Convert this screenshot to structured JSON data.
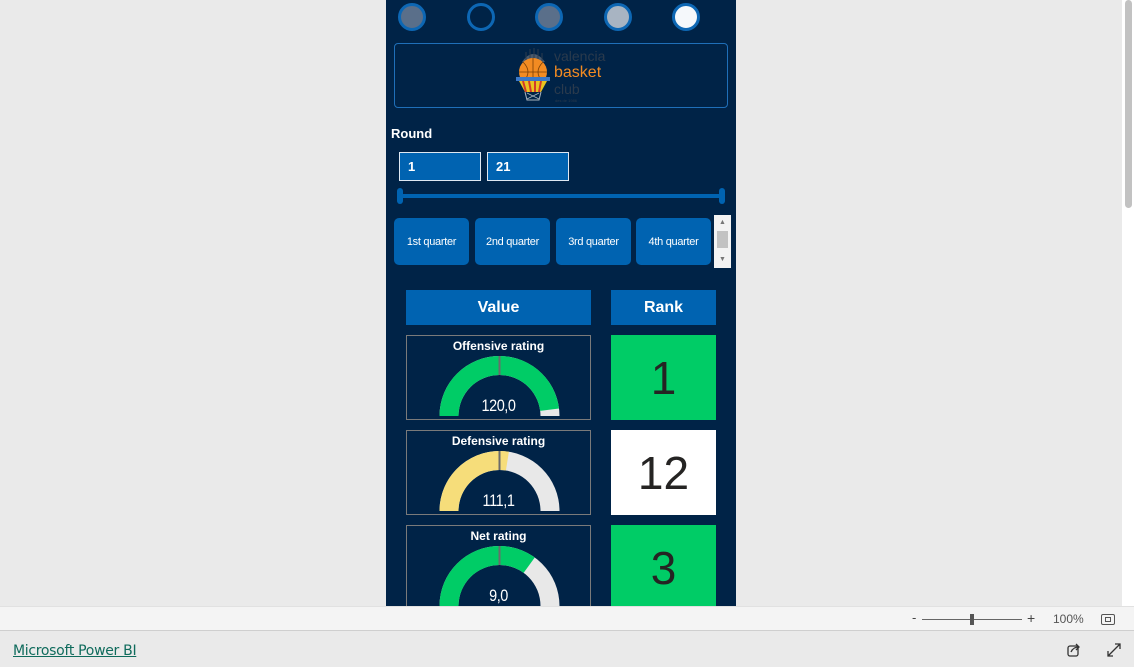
{
  "nav_dots": [
    {
      "name": "page-1",
      "fill": "#5a6f8a"
    },
    {
      "name": "page-2",
      "fill": "#002347"
    },
    {
      "name": "page-3",
      "fill": "#5a6f8a"
    },
    {
      "name": "page-4",
      "fill": "#a8b4c2"
    },
    {
      "name": "page-5",
      "fill": "#f5f8fb",
      "active": true
    }
  ],
  "logo": {
    "line1": "valencia",
    "line2": "basket",
    "line3": "club",
    "tagline": "des de 1986",
    "badge_text": "VALENCIA BASKET"
  },
  "filter": {
    "label": "Round",
    "from": "1",
    "to": "21",
    "min_pct": 0,
    "max_pct": 100
  },
  "quarters": [
    "1st quarter",
    "2nd quarter",
    "3rd quarter",
    "4th quarter"
  ],
  "table": {
    "value_header": "Value",
    "rank_header": "Rank",
    "rows": [
      {
        "title": "Offensive rating",
        "value": "120,0",
        "fill_pct": 96,
        "target_pct": 50,
        "color": "#00cc66",
        "rank": "1",
        "rank_bg": "#00cc66"
      },
      {
        "title": "Defensive rating",
        "value": "111,1",
        "fill_pct": 55,
        "target_pct": 50,
        "color": "#f6dd7a",
        "rank": "12",
        "rank_bg": "#ffffff"
      },
      {
        "title": "Net rating",
        "value": "9,0",
        "fill_pct": 70,
        "target_pct": 50,
        "color": "#00cc66",
        "rank": "3",
        "rank_bg": "#00cc66"
      }
    ]
  },
  "colors": {
    "background": "#002347",
    "accent": "#0063b1",
    "gauge_track": "#e8e8e8",
    "good": "#00cc66",
    "neutral": "#f6dd7a"
  },
  "zoom": {
    "minus": "-",
    "plus": "+",
    "level": "100%",
    "level_pct": 50
  },
  "footer": {
    "brand_link": "Microsoft Power BI"
  }
}
